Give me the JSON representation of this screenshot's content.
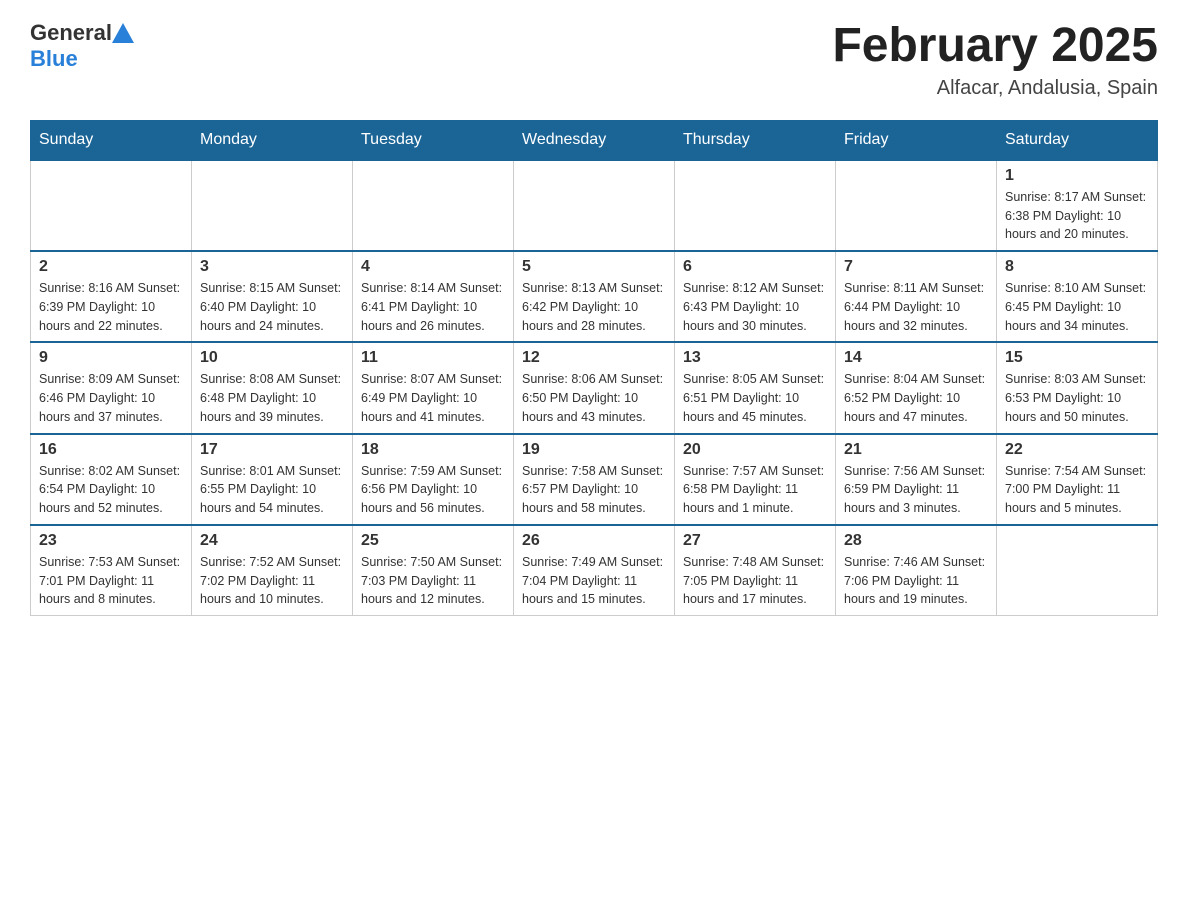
{
  "header": {
    "logo_general": "General",
    "logo_blue": "Blue",
    "title": "February 2025",
    "subtitle": "Alfacar, Andalusia, Spain"
  },
  "days_of_week": [
    "Sunday",
    "Monday",
    "Tuesday",
    "Wednesday",
    "Thursday",
    "Friday",
    "Saturday"
  ],
  "weeks": [
    [
      {
        "day": "",
        "info": ""
      },
      {
        "day": "",
        "info": ""
      },
      {
        "day": "",
        "info": ""
      },
      {
        "day": "",
        "info": ""
      },
      {
        "day": "",
        "info": ""
      },
      {
        "day": "",
        "info": ""
      },
      {
        "day": "1",
        "info": "Sunrise: 8:17 AM\nSunset: 6:38 PM\nDaylight: 10 hours and 20 minutes."
      }
    ],
    [
      {
        "day": "2",
        "info": "Sunrise: 8:16 AM\nSunset: 6:39 PM\nDaylight: 10 hours and 22 minutes."
      },
      {
        "day": "3",
        "info": "Sunrise: 8:15 AM\nSunset: 6:40 PM\nDaylight: 10 hours and 24 minutes."
      },
      {
        "day": "4",
        "info": "Sunrise: 8:14 AM\nSunset: 6:41 PM\nDaylight: 10 hours and 26 minutes."
      },
      {
        "day": "5",
        "info": "Sunrise: 8:13 AM\nSunset: 6:42 PM\nDaylight: 10 hours and 28 minutes."
      },
      {
        "day": "6",
        "info": "Sunrise: 8:12 AM\nSunset: 6:43 PM\nDaylight: 10 hours and 30 minutes."
      },
      {
        "day": "7",
        "info": "Sunrise: 8:11 AM\nSunset: 6:44 PM\nDaylight: 10 hours and 32 minutes."
      },
      {
        "day": "8",
        "info": "Sunrise: 8:10 AM\nSunset: 6:45 PM\nDaylight: 10 hours and 34 minutes."
      }
    ],
    [
      {
        "day": "9",
        "info": "Sunrise: 8:09 AM\nSunset: 6:46 PM\nDaylight: 10 hours and 37 minutes."
      },
      {
        "day": "10",
        "info": "Sunrise: 8:08 AM\nSunset: 6:48 PM\nDaylight: 10 hours and 39 minutes."
      },
      {
        "day": "11",
        "info": "Sunrise: 8:07 AM\nSunset: 6:49 PM\nDaylight: 10 hours and 41 minutes."
      },
      {
        "day": "12",
        "info": "Sunrise: 8:06 AM\nSunset: 6:50 PM\nDaylight: 10 hours and 43 minutes."
      },
      {
        "day": "13",
        "info": "Sunrise: 8:05 AM\nSunset: 6:51 PM\nDaylight: 10 hours and 45 minutes."
      },
      {
        "day": "14",
        "info": "Sunrise: 8:04 AM\nSunset: 6:52 PM\nDaylight: 10 hours and 47 minutes."
      },
      {
        "day": "15",
        "info": "Sunrise: 8:03 AM\nSunset: 6:53 PM\nDaylight: 10 hours and 50 minutes."
      }
    ],
    [
      {
        "day": "16",
        "info": "Sunrise: 8:02 AM\nSunset: 6:54 PM\nDaylight: 10 hours and 52 minutes."
      },
      {
        "day": "17",
        "info": "Sunrise: 8:01 AM\nSunset: 6:55 PM\nDaylight: 10 hours and 54 minutes."
      },
      {
        "day": "18",
        "info": "Sunrise: 7:59 AM\nSunset: 6:56 PM\nDaylight: 10 hours and 56 minutes."
      },
      {
        "day": "19",
        "info": "Sunrise: 7:58 AM\nSunset: 6:57 PM\nDaylight: 10 hours and 58 minutes."
      },
      {
        "day": "20",
        "info": "Sunrise: 7:57 AM\nSunset: 6:58 PM\nDaylight: 11 hours and 1 minute."
      },
      {
        "day": "21",
        "info": "Sunrise: 7:56 AM\nSunset: 6:59 PM\nDaylight: 11 hours and 3 minutes."
      },
      {
        "day": "22",
        "info": "Sunrise: 7:54 AM\nSunset: 7:00 PM\nDaylight: 11 hours and 5 minutes."
      }
    ],
    [
      {
        "day": "23",
        "info": "Sunrise: 7:53 AM\nSunset: 7:01 PM\nDaylight: 11 hours and 8 minutes."
      },
      {
        "day": "24",
        "info": "Sunrise: 7:52 AM\nSunset: 7:02 PM\nDaylight: 11 hours and 10 minutes."
      },
      {
        "day": "25",
        "info": "Sunrise: 7:50 AM\nSunset: 7:03 PM\nDaylight: 11 hours and 12 minutes."
      },
      {
        "day": "26",
        "info": "Sunrise: 7:49 AM\nSunset: 7:04 PM\nDaylight: 11 hours and 15 minutes."
      },
      {
        "day": "27",
        "info": "Sunrise: 7:48 AM\nSunset: 7:05 PM\nDaylight: 11 hours and 17 minutes."
      },
      {
        "day": "28",
        "info": "Sunrise: 7:46 AM\nSunset: 7:06 PM\nDaylight: 11 hours and 19 minutes."
      },
      {
        "day": "",
        "info": ""
      }
    ]
  ]
}
